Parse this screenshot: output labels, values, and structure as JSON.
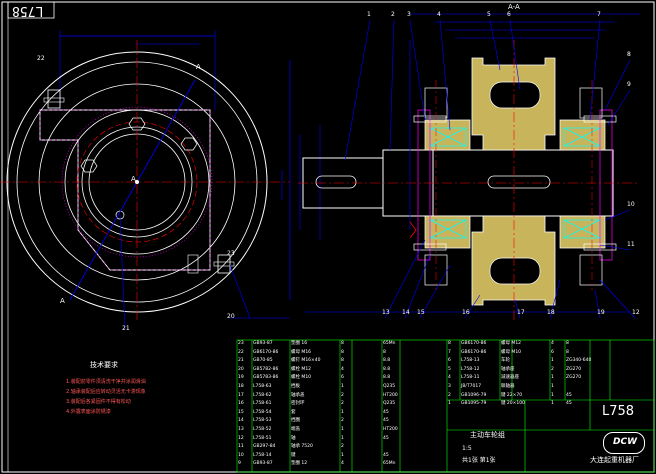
{
  "drawing": {
    "code": "L758",
    "section_label": "A-A",
    "view_marker": "A",
    "tech_req_title": "技术要求",
    "tech_req_lines": [
      "1.装配前零件须清洗干净并涂润滑油",
      "2.轴承装配后应转动灵活无卡滞现象",
      "3.装配后各紧固件不得有松动",
      "4.外露表面涂防锈漆"
    ],
    "balloons": [
      "1",
      "2",
      "3",
      "4",
      "5",
      "6",
      "7",
      "8",
      "9",
      "10",
      "11",
      "12",
      "13",
      "14",
      "15",
      "16",
      "17",
      "18",
      "19",
      "20",
      "21",
      "22",
      "23"
    ],
    "title_block": {
      "name": "主动车轮组",
      "code": "L758",
      "company": "大连起重机器厂",
      "logo_text": "DCW",
      "scale": "1:5",
      "sheet": "共1张 第1张"
    },
    "parts_left": [
      [
        "23",
        "GB93-87",
        "垫圈 16",
        "8",
        "65Mn"
      ],
      [
        "22",
        "GB6170-86",
        "螺母 M16",
        "8",
        "8"
      ],
      [
        "21",
        "GB70-85",
        "螺钉 M16×40",
        "8",
        "8.8"
      ],
      [
        "20",
        "GB5782-86",
        "螺栓 M12",
        "4",
        "8.8"
      ],
      [
        "19",
        "GB5783-86",
        "螺栓 M10",
        "6",
        "8.8"
      ],
      [
        "18",
        "L758-63",
        "挡板",
        "1",
        "Q235"
      ],
      [
        "17",
        "L758-62",
        "轴承盖",
        "2",
        "HT200"
      ],
      [
        "16",
        "L758-61",
        "密封环",
        "2",
        "Q235"
      ],
      [
        "15",
        "L758-54",
        "套",
        "1",
        "45"
      ],
      [
        "14",
        "L758-53",
        "挡圈",
        "2",
        "45"
      ],
      [
        "13",
        "L758-52",
        "端盖",
        "1",
        "HT200"
      ],
      [
        "12",
        "L758-51",
        "轴",
        "1",
        "45"
      ],
      [
        "11",
        "GB297-84",
        "轴承 7520",
        "2",
        ""
      ],
      [
        "10",
        "L758-14",
        "键",
        "1",
        "45"
      ],
      [
        "9",
        "GB93-87",
        "垫圈 12",
        "4",
        "65Mn"
      ]
    ],
    "parts_right": [
      [
        "8",
        "GB6170-86",
        "螺母 M12",
        "4",
        "8"
      ],
      [
        "7",
        "GB6170-86",
        "螺母 M10",
        "6",
        "8"
      ],
      [
        "6",
        "L758-13",
        "车轮",
        "1",
        "ZG340-640"
      ],
      [
        "5",
        "L758-12",
        "轴承座",
        "2",
        "ZG270"
      ],
      [
        "4",
        "L758-11",
        "减速器座",
        "1",
        "ZG270"
      ],
      [
        "3",
        "JB/T7017",
        "联轴器",
        "1",
        ""
      ],
      [
        "2",
        "GB1096-79",
        "键 22×70",
        "1",
        "45"
      ],
      [
        "1",
        "GB1095-79",
        "键 20×100",
        "1",
        "45"
      ]
    ],
    "colors": {
      "outline": "#ffffff",
      "centerline": "#ff0000",
      "dimension": "#0000ff",
      "wheel_fill": "#c8b45a",
      "bearing": "#00ffff",
      "hatch": "#ff00ff",
      "table_line": "#00ff00",
      "balloon": "#0000ff"
    }
  }
}
